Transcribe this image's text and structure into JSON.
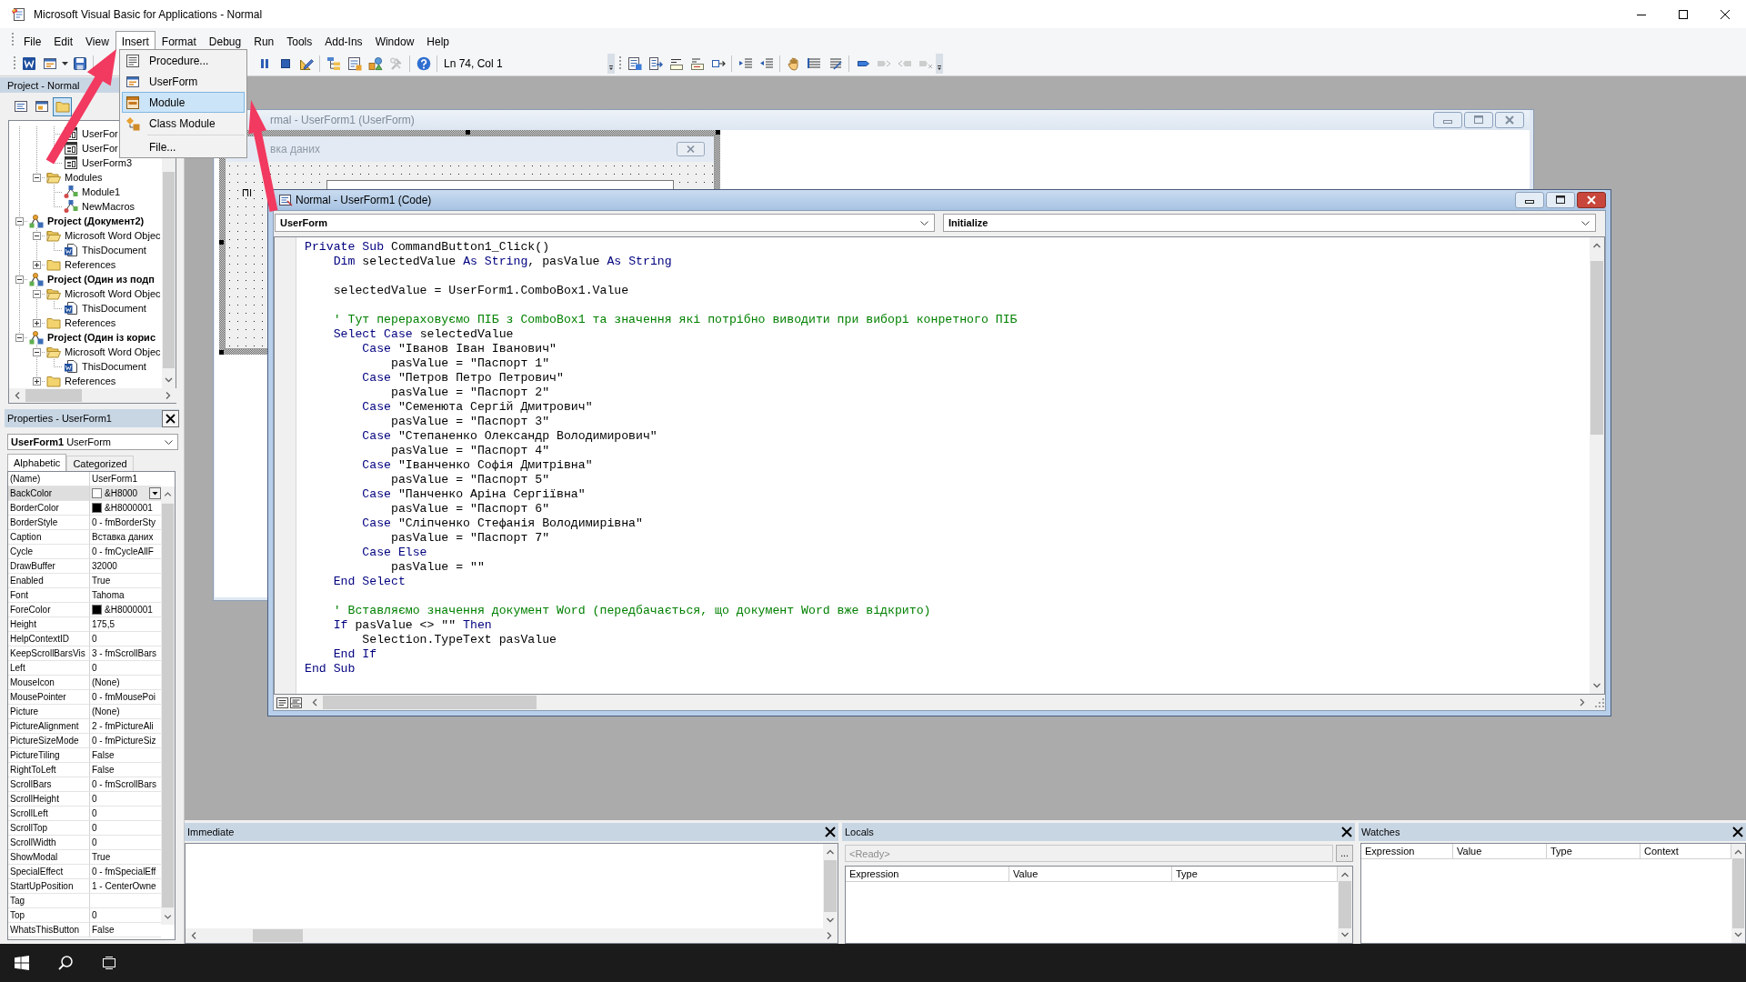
{
  "window": {
    "title": "Microsoft Visual Basic for Applications - Normal"
  },
  "menu_bar": [
    {
      "label": "File",
      "selected": false
    },
    {
      "label": "Edit",
      "selected": false
    },
    {
      "label": "View",
      "selected": false
    },
    {
      "label": "Insert",
      "selected": true
    },
    {
      "label": "Format",
      "selected": false
    },
    {
      "label": "Debug",
      "selected": false
    },
    {
      "label": "Run",
      "selected": false
    },
    {
      "label": "Tools",
      "selected": false
    },
    {
      "label": "Add-Ins",
      "selected": false
    },
    {
      "label": "Window",
      "selected": false
    },
    {
      "label": "Help",
      "selected": false
    }
  ],
  "insert_menu": {
    "groups": [
      [
        {
          "label": "Procedure...",
          "kind": "procedure",
          "selected": false
        },
        {
          "label": "UserForm",
          "kind": "userform",
          "selected": false
        },
        {
          "label": "Module",
          "kind": "module",
          "selected": true
        },
        {
          "label": "Class Module",
          "kind": "class",
          "selected": false
        }
      ],
      [
        {
          "label": "File...",
          "kind": "file",
          "selected": false
        }
      ]
    ]
  },
  "standard_toolbar": {
    "groups": [
      [
        {
          "kind": "word",
          "disabled": false
        },
        {
          "kind": "userform",
          "disabled": false
        },
        {
          "kind": "caret",
          "disabled": false
        },
        {
          "kind": "save",
          "disabled": false
        }
      ],
      [
        {
          "kind": "pause",
          "disabled": false
        },
        {
          "kind": "stop",
          "disabled": false
        },
        {
          "kind": "design",
          "disabled": false
        }
      ],
      [
        {
          "kind": "project",
          "disabled": false
        },
        {
          "kind": "properties",
          "disabled": false
        },
        {
          "kind": "browser",
          "disabled": false
        },
        {
          "kind": "toolbox",
          "disabled": true
        }
      ],
      [
        {
          "kind": "help",
          "disabled": false
        }
      ]
    ],
    "position": "Ln 74, Col 1"
  },
  "edit_toolbar": {
    "groups": [
      [
        {
          "kind": "listprops",
          "disabled": false
        },
        {
          "kind": "constants",
          "disabled": false
        },
        {
          "kind": "quickinfo",
          "disabled": false
        },
        {
          "kind": "paraminfo",
          "disabled": false
        },
        {
          "kind": "complete",
          "disabled": false
        }
      ],
      [
        {
          "kind": "indent",
          "disabled": false
        },
        {
          "kind": "outdent",
          "disabled": false
        }
      ],
      [
        {
          "kind": "breakpoint",
          "disabled": false
        },
        {
          "kind": "comment",
          "disabled": false
        },
        {
          "kind": "uncomment",
          "disabled": false
        }
      ],
      [
        {
          "kind": "bookmark",
          "disabled": false
        },
        {
          "kind": "nextmark",
          "disabled": true
        },
        {
          "kind": "prevmark",
          "disabled": true
        },
        {
          "kind": "clearmarks",
          "disabled": true
        }
      ]
    ]
  },
  "project_explorer": {
    "title": "Project - Normal",
    "buttons": [
      {
        "kind": "code",
        "selected": false
      },
      {
        "kind": "object",
        "selected": false
      },
      {
        "kind": "folders",
        "selected": true
      }
    ],
    "tree": [
      {
        "children": [
          {
            "children": [
              {
                "label": "UserFor",
                "kind": "form"
              },
              {
                "label": "UserFor",
                "kind": "form"
              },
              {
                "label": "UserForm3",
                "kind": "form"
              }
            ]
          },
          {
            "label": "Modules",
            "kind": "folder",
            "expanded": true,
            "children": [
              {
                "label": "Module1",
                "kind": "module"
              },
              {
                "label": "NewMacros",
                "kind": "module"
              }
            ]
          }
        ]
      },
      {
        "label": "Project (Документ2)",
        "kind": "project",
        "expanded": true,
        "children": [
          {
            "label": "Microsoft Word Objec",
            "kind": "folder",
            "expanded": true,
            "children": [
              {
                "label": "ThisDocument",
                "kind": "document"
              }
            ]
          },
          {
            "label": "References",
            "kind": "folder",
            "expanded": false
          }
        ]
      },
      {
        "label": "Project (Один из подп",
        "kind": "project",
        "expanded": true,
        "children": [
          {
            "label": "Microsoft Word Objec",
            "kind": "folder",
            "expanded": true,
            "children": [
              {
                "label": "ThisDocument",
                "kind": "document"
              }
            ]
          },
          {
            "label": "References",
            "kind": "folder",
            "expanded": false
          }
        ]
      },
      {
        "label": "Project (Один із корис",
        "kind": "project",
        "expanded": true,
        "children": [
          {
            "label": "Microsoft Word Objec",
            "kind": "folder",
            "expanded": true,
            "children": [
              {
                "label": "ThisDocument",
                "kind": "document"
              }
            ]
          },
          {
            "label": "References",
            "kind": "folder",
            "expanded": false
          }
        ]
      }
    ]
  },
  "properties": {
    "title": "Properties - UserForm1",
    "object": "**UserForm1** UserForm",
    "tabs": [
      {
        "label": "Alphabetic",
        "selected": true
      },
      {
        "label": "Categorized",
        "selected": false
      }
    ],
    "rows": [
      {
        "name": "(Name)",
        "value": "UserForm1",
        "selected": false
      },
      {
        "name": "BackColor",
        "value": "&H8000",
        "color": "#ffffff",
        "selected": true
      },
      {
        "name": "BorderColor",
        "value": "&H8000001",
        "color": "#000000",
        "selected": false
      },
      {
        "name": "BorderStyle",
        "value": "0 - fmBorderSty",
        "selected": false
      },
      {
        "name": "Caption",
        "value": "Вставка даних",
        "selected": false
      },
      {
        "name": "Cycle",
        "value": "0 - fmCycleAllF",
        "selected": false
      },
      {
        "name": "DrawBuffer",
        "value": "32000",
        "selected": false
      },
      {
        "name": "Enabled",
        "value": "True",
        "selected": false
      },
      {
        "name": "Font",
        "value": "Tahoma",
        "selected": false
      },
      {
        "name": "ForeColor",
        "value": "&H8000001",
        "color": "#000000",
        "selected": false
      },
      {
        "name": "Height",
        "value": "175,5",
        "selected": false
      },
      {
        "name": "HelpContextID",
        "value": "0",
        "selected": false
      },
      {
        "name": "KeepScrollBarsVis",
        "value": "3 - fmScrollBars",
        "selected": false
      },
      {
        "name": "Left",
        "value": "0",
        "selected": false
      },
      {
        "name": "MouseIcon",
        "value": "(None)",
        "selected": false
      },
      {
        "name": "MousePointer",
        "value": "0 - fmMousePoi",
        "selected": false
      },
      {
        "name": "Picture",
        "value": "(None)",
        "selected": false
      },
      {
        "name": "PictureAlignment",
        "value": "2 - fmPictureAli",
        "selected": false
      },
      {
        "name": "PictureSizeMode",
        "value": "0 - fmPictureSiz",
        "selected": false
      },
      {
        "name": "PictureTiling",
        "value": "False",
        "selected": false
      },
      {
        "name": "RightToLeft",
        "value": "False",
        "selected": false
      },
      {
        "name": "ScrollBars",
        "value": "0 - fmScrollBars",
        "selected": false
      },
      {
        "name": "ScrollHeight",
        "value": "0",
        "selected": false
      },
      {
        "name": "ScrollLeft",
        "value": "0",
        "selected": false
      },
      {
        "name": "ScrollTop",
        "value": "0",
        "selected": false
      },
      {
        "name": "ScrollWidth",
        "value": "0",
        "selected": false
      },
      {
        "name": "ShowModal",
        "value": "True",
        "selected": false
      },
      {
        "name": "SpecialEffect",
        "value": "0 - fmSpecialEff",
        "selected": false
      },
      {
        "name": "StartUpPosition",
        "value": "1 - CenterOwne",
        "selected": false
      },
      {
        "name": "Tag",
        "selected": false
      },
      {
        "name": "Top",
        "value": "0",
        "selected": false
      },
      {
        "name": "WhatsThisButton",
        "value": "False",
        "selected": false
      }
    ]
  },
  "userform_window": {
    "title": "rmal - UserForm1 (UserForm)",
    "active": false,
    "form": {
      "caption": "вка даних",
      "label": "ПІ"
    }
  },
  "code_window": {
    "title": "Normal - UserForm1 (Code)",
    "active": true,
    "object": "UserForm",
    "procedure": "Initialize",
    "lines": [
      [
        {
          "kind": "keyword",
          "text": "Private Sub"
        },
        {
          "kind": "plain",
          "text": " CommandButton1_Click()"
        }
      ],
      [
        {
          "kind": "keyword",
          "text": "    Dim"
        },
        {
          "kind": "plain",
          "text": " selectedValue "
        },
        {
          "kind": "keyword",
          "text": "As String"
        },
        {
          "kind": "plain",
          "text": ", pasValue "
        },
        {
          "kind": "keyword",
          "text": "As String"
        }
      ],
      [
        {
          "kind": "blank"
        }
      ],
      [
        {
          "kind": "plain",
          "text": "    selectedValue = UserForm1.ComboBox1.Value"
        }
      ],
      [
        {
          "kind": "blank"
        }
      ],
      [
        {
          "kind": "comment",
          "text": "    ' Тут перераховуємо ПІБ з ComboBox1 та значення які потрібно виводити при виборі конретного ПІБ"
        }
      ],
      [
        {
          "kind": "keyword",
          "text": "    Select Case"
        },
        {
          "kind": "plain",
          "text": " selectedValue"
        }
      ],
      [
        {
          "kind": "keyword",
          "text": "        Case"
        },
        {
          "kind": "plain",
          "text": " \"Іванов Іван Іванович\""
        }
      ],
      [
        {
          "kind": "plain",
          "text": "            pasValue = \"Паспорт 1\""
        }
      ],
      [
        {
          "kind": "keyword",
          "text": "        Case"
        },
        {
          "kind": "plain",
          "text": " \"Петров Петро Петрович\""
        }
      ],
      [
        {
          "kind": "plain",
          "text": "            pasValue = \"Паспорт 2\""
        }
      ],
      [
        {
          "kind": "keyword",
          "text": "        Case"
        },
        {
          "kind": "plain",
          "text": " \"Семенюта Сергій Дмитрович\""
        }
      ],
      [
        {
          "kind": "plain",
          "text": "            pasValue = \"Паспорт 3\""
        }
      ],
      [
        {
          "kind": "keyword",
          "text": "        Case"
        },
        {
          "kind": "plain",
          "text": " \"Степаненко Олександр Володимирович\""
        }
      ],
      [
        {
          "kind": "plain",
          "text": "            pasValue = \"Паспорт 4\""
        }
      ],
      [
        {
          "kind": "keyword",
          "text": "        Case"
        },
        {
          "kind": "plain",
          "text": " \"Іванченко Софія Дмитрівна\""
        }
      ],
      [
        {
          "kind": "plain",
          "text": "            pasValue = \"Паспорт 5\""
        }
      ],
      [
        {
          "kind": "keyword",
          "text": "        Case"
        },
        {
          "kind": "plain",
          "text": " \"Панченко Аріна Сергіївна\""
        }
      ],
      [
        {
          "kind": "plain",
          "text": "            pasValue = \"Паспорт 6\""
        }
      ],
      [
        {
          "kind": "keyword",
          "text": "        Case"
        },
        {
          "kind": "plain",
          "text": " \"Сліпченко Стефанія Володимирівна\""
        }
      ],
      [
        {
          "kind": "plain",
          "text": "            pasValue = \"Паспорт 7\""
        }
      ],
      [
        {
          "kind": "keyword",
          "text": "        Case Else"
        }
      ],
      [
        {
          "kind": "plain",
          "text": "            pasValue = \"\""
        }
      ],
      [
        {
          "kind": "keyword",
          "text": "    End Select"
        }
      ],
      [
        {
          "kind": "blank"
        }
      ],
      [
        {
          "kind": "comment",
          "text": "    ' Вставляємо значення документ Word (передбачається, що документ Word вже відкрито)"
        }
      ],
      [
        {
          "kind": "keyword",
          "text": "    If"
        },
        {
          "kind": "plain",
          "text": " pasValue <> \"\" "
        },
        {
          "kind": "keyword",
          "text": "Then"
        }
      ],
      [
        {
          "kind": "plain",
          "text": "        Selection.TypeText pasValue"
        }
      ],
      [
        {
          "kind": "keyword",
          "text": "    End If"
        }
      ],
      [
        {
          "kind": "keyword",
          "text": "End Sub"
        }
      ]
    ]
  },
  "immediate": {
    "title": "Immediate"
  },
  "locals": {
    "title": "Locals",
    "context": "<Ready>",
    "button": "...",
    "columns": [
      "Expression",
      "Value",
      "Type"
    ]
  },
  "watches": {
    "title": "Watches",
    "columns": [
      "Expression",
      "Value",
      "Type",
      "Context"
    ]
  },
  "taskbar": {
    "buttons": [
      {
        "kind": "start"
      },
      {
        "kind": "search"
      },
      {
        "kind": "taskview"
      }
    ]
  }
}
